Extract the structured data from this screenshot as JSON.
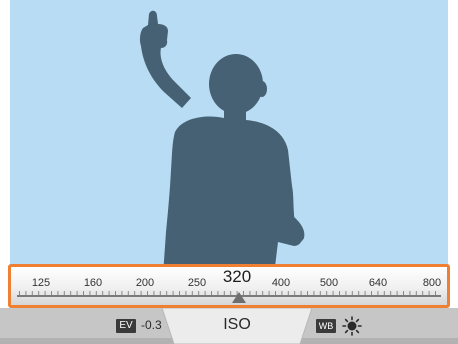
{
  "iso_scale": {
    "values": [
      "125",
      "160",
      "200",
      "250",
      "320",
      "400",
      "500",
      "640",
      "800"
    ],
    "selected": "320"
  },
  "bottom_bar": {
    "ev_label": "EV",
    "ev_value": "-0.3",
    "iso_tab_label": "ISO",
    "wb_label": "WB",
    "wb_icon": "sun-icon"
  },
  "colors": {
    "sky": "#b8dcf3",
    "silhouette": "#456173",
    "highlight": "#ee7f33"
  }
}
